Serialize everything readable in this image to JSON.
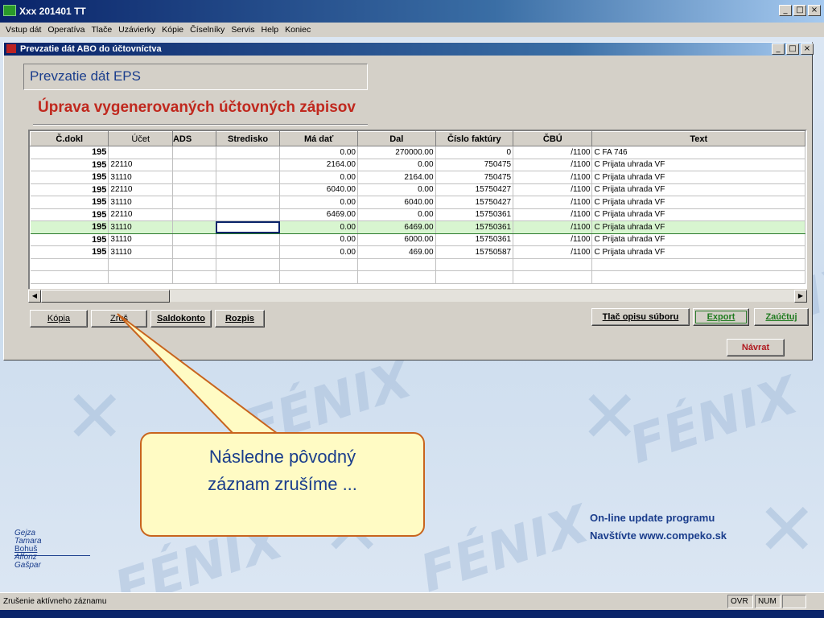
{
  "window": {
    "title": "Xxx 201401 TT"
  },
  "menu": [
    "Vstup dát",
    "Operatíva",
    "Tlače",
    "Uzávierky",
    "Kópie",
    "Číselníky",
    "Servis",
    "Help",
    "Koniec"
  ],
  "child_window": {
    "title": "Prevzatie dát ABO do účtovníctva",
    "section_title": "Prevzatie dát EPS",
    "sub_title": "Úprava vygenerovaných účtovných zápisov"
  },
  "grid": {
    "columns": [
      "Č.dokl",
      "Účet",
      "ADS",
      "Stredisko",
      "Má dať",
      "Dal",
      "Číslo faktúry",
      "ČBÚ",
      "Text"
    ],
    "rows": [
      [
        "195",
        "",
        "",
        "",
        "0.00",
        "270000.00",
        "0",
        "/1100",
        "C FA 746"
      ],
      [
        "195",
        "22110",
        "",
        "",
        "2164.00",
        "0.00",
        "750475",
        "/1100",
        "C Prijata uhrada VF"
      ],
      [
        "195",
        "31110",
        "",
        "",
        "0.00",
        "2164.00",
        "750475",
        "/1100",
        "C Prijata uhrada VF"
      ],
      [
        "195",
        "22110",
        "",
        "",
        "6040.00",
        "0.00",
        "15750427",
        "/1100",
        "C Prijata uhrada VF"
      ],
      [
        "195",
        "31110",
        "",
        "",
        "0.00",
        "6040.00",
        "15750427",
        "/1100",
        "C Prijata uhrada VF"
      ],
      [
        "195",
        "22110",
        "",
        "",
        "6469.00",
        "0.00",
        "15750361",
        "/1100",
        "C Prijata uhrada VF"
      ],
      [
        "195",
        "31110",
        "",
        "",
        "0.00",
        "6469.00",
        "15750361",
        "/1100",
        "C Prijata uhrada VF"
      ],
      [
        "195",
        "31110",
        "",
        "",
        "0.00",
        "6000.00",
        "15750361",
        "/1100",
        "C Prijata uhrada VF"
      ],
      [
        "195",
        "31110",
        "",
        "",
        "0.00",
        "469.00",
        "15750587",
        "/1100",
        "C Prijata uhrada VF"
      ],
      [
        "",
        "",
        "",
        "",
        "",
        "",
        "",
        "",
        ""
      ],
      [
        "",
        "",
        "",
        "",
        "",
        "",
        "",
        "",
        ""
      ]
    ],
    "selected_row": 6
  },
  "buttons": {
    "kopia": "Kópia",
    "zrus": "Zruš",
    "saldokonto": "Saldokonto",
    "rozpis": "Rozpis",
    "tlac": "Tlač opisu súboru",
    "export": "Export",
    "zauctuj": "Zaúčtuj",
    "navrat": "Návrat"
  },
  "callout": {
    "line1": "Následne pôvodný",
    "line2": "záznam zrušíme ..."
  },
  "promo": {
    "line1": "On-line update programu",
    "line2": "Navštívte www.compeko.sk"
  },
  "names": [
    "Gejza",
    "Tamara",
    "Bohuš",
    "Alfonz",
    "Gašpar"
  ],
  "watermark": "FÉNIX",
  "status": {
    "text": "Zrušenie aktívneho záznamu",
    "ovr": "OVR",
    "num": "NUM"
  },
  "colors": {
    "accent": "#0a246a",
    "title_red": "#c0281e",
    "callout_bg": "#fffbc4",
    "selected_row": "#d8f5d0"
  }
}
